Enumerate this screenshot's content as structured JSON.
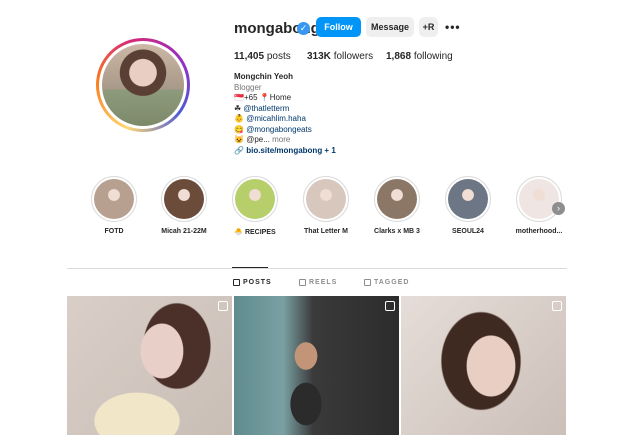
{
  "profile": {
    "username": "mongabong",
    "verified_glyph": "✓",
    "follow_label": "Follow",
    "message_label": "Message",
    "add_user_glyph": "+R",
    "more_glyph": "•••"
  },
  "stats": {
    "posts_count": "11,405",
    "posts_label": "posts",
    "followers_count": "313K",
    "followers_label": "followers",
    "following_count": "1,868",
    "following_label": "following"
  },
  "bio": {
    "name": "Mongchin Yeoh",
    "category": "Blogger",
    "line1": "+65 📍Home",
    "line1_prefix": "🇸🇬",
    "line2_prefix": "☘",
    "line2_handle": "@thatletterm",
    "line3_prefix": "👶",
    "line3_handle": "@micahlim.haha",
    "line4_prefix": "😋",
    "line4_handle": "@mongabongeats",
    "line5_prefix": "😺",
    "line5_text": "@pe...",
    "line5_more": "more",
    "link_icon": "🔗",
    "link_text": "bio.site/mongabong + 1"
  },
  "highlights": [
    {
      "label": "FOTD",
      "color": "#b8a090"
    },
    {
      "label": "Micah 21-22M",
      "color": "#6b4c3b"
    },
    {
      "label": "🐣 RECIPES",
      "color": "#b7cf6a"
    },
    {
      "label": "That Letter M",
      "color": "#d7c7bd"
    },
    {
      "label": "Clarks x MB 3",
      "color": "#8c7766"
    },
    {
      "label": "SEOUL24",
      "color": "#6c7684"
    },
    {
      "label": "motherhood...",
      "color": "#efe5e3"
    }
  ],
  "highlights_next_glyph": "›",
  "tabs": [
    {
      "label": "POSTS",
      "icon": "grid-icon",
      "active": true
    },
    {
      "label": "REELS",
      "icon": "reels-icon",
      "active": false
    },
    {
      "label": "TAGGED",
      "icon": "tagged-icon",
      "active": false
    }
  ],
  "posts": [
    {
      "badge": "reel-icon"
    },
    {
      "badge": "carousel-icon"
    },
    {
      "badge": "reel-icon"
    }
  ],
  "colors": {
    "accent": "#0095f6",
    "verified": "#3897f0",
    "link": "#00376b"
  }
}
